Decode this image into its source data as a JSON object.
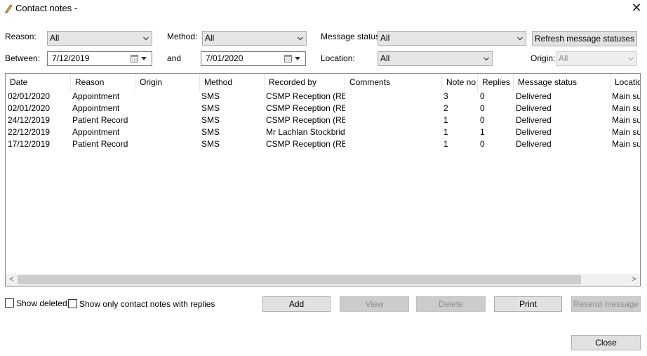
{
  "window": {
    "title": "Contact notes -"
  },
  "filters": {
    "reason_label": "Reason:",
    "reason_value": "All",
    "method_label": "Method:",
    "method_value": "All",
    "message_status_label": "Message status:",
    "message_status_value": "All",
    "refresh_button": "Refresh message statuses",
    "between_label": "Between:",
    "from_date": "7/12/2019",
    "and_label": "and",
    "to_date": "7/01/2020",
    "location_label": "Location:",
    "location_value": "All",
    "origin_label": "Origin:",
    "origin_value": "All"
  },
  "table": {
    "columns": [
      "Date",
      "Reason",
      "Origin",
      "Method",
      "Recorded by",
      "Comments",
      "Note no",
      "Replies",
      "Message status",
      "Location"
    ],
    "rows": [
      [
        "02/01/2020",
        "Appointment",
        "",
        "SMS",
        "CSMP Reception (REC-",
        "",
        "3",
        "0",
        "Delivered",
        "Main sur"
      ],
      [
        "02/01/2020",
        "Appointment",
        "",
        "SMS",
        "CSMP Reception (REC-",
        "",
        "2",
        "0",
        "Delivered",
        "Main sur"
      ],
      [
        "24/12/2019",
        "Patient Record",
        "",
        "SMS",
        "CSMP Reception (REC-",
        "",
        "1",
        "0",
        "Delivered",
        "Main sur"
      ],
      [
        "22/12/2019",
        "Appointment",
        "",
        "SMS",
        "Mr Lachlan Stockbridge",
        "",
        "1",
        "1",
        "Delivered",
        "Main sur"
      ],
      [
        "17/12/2019",
        "Patient Record",
        "",
        "SMS",
        "CSMP Reception (REC-",
        "",
        "1",
        "0",
        "Delivered",
        "Main sur"
      ]
    ]
  },
  "options": {
    "show_deleted": "Show deleted",
    "show_only_replies": "Show only contact notes with replies"
  },
  "actions": {
    "add": "Add",
    "view": "View",
    "delete": "Delete",
    "print": "Print",
    "resend": "Resend message",
    "close": "Close"
  },
  "icons": {
    "title": "pencil-icon",
    "close": "close-icon",
    "calendar": "calendar-icon",
    "dropdown": "chevron-down-icon"
  }
}
